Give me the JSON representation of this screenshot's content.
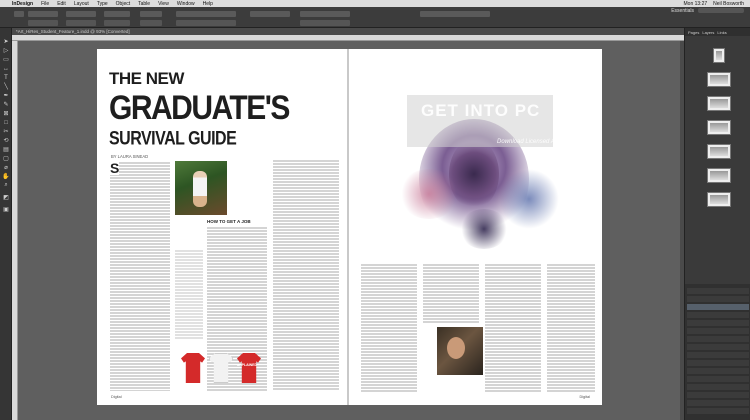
{
  "menubar": {
    "app": "InDesign",
    "items": [
      "File",
      "Edit",
      "Layout",
      "Type",
      "Object",
      "Table",
      "View",
      "Window",
      "Help"
    ],
    "clock": "Mon 13:27",
    "user": "Neil Bosworth"
  },
  "controlbar": {
    "workspace": "Essentials"
  },
  "document": {
    "tab_title": "*Art_HiRes_Student_Feature_1.indd @ 93% [Converted]"
  },
  "panels": {
    "tabs": [
      "Pages",
      "Layers",
      "Links"
    ]
  },
  "magazine": {
    "headline_line1": "THE NEW",
    "headline_line2": "GRADUATE'S",
    "headline_line3": "SURVIVAL GUIDE",
    "byline": "BY LAURA SINEAD",
    "section_head": "HOW TO GET A JOB",
    "tshirt_text": "EXPLAINED",
    "footer_left": "Digital",
    "footer_right": "Digital"
  },
  "watermark": {
    "title": "GET INTO PC",
    "subtitle": "Download Licensed App"
  },
  "colors": {
    "accent": "#d42a2a",
    "pasteboard": "#5f5f5f"
  }
}
